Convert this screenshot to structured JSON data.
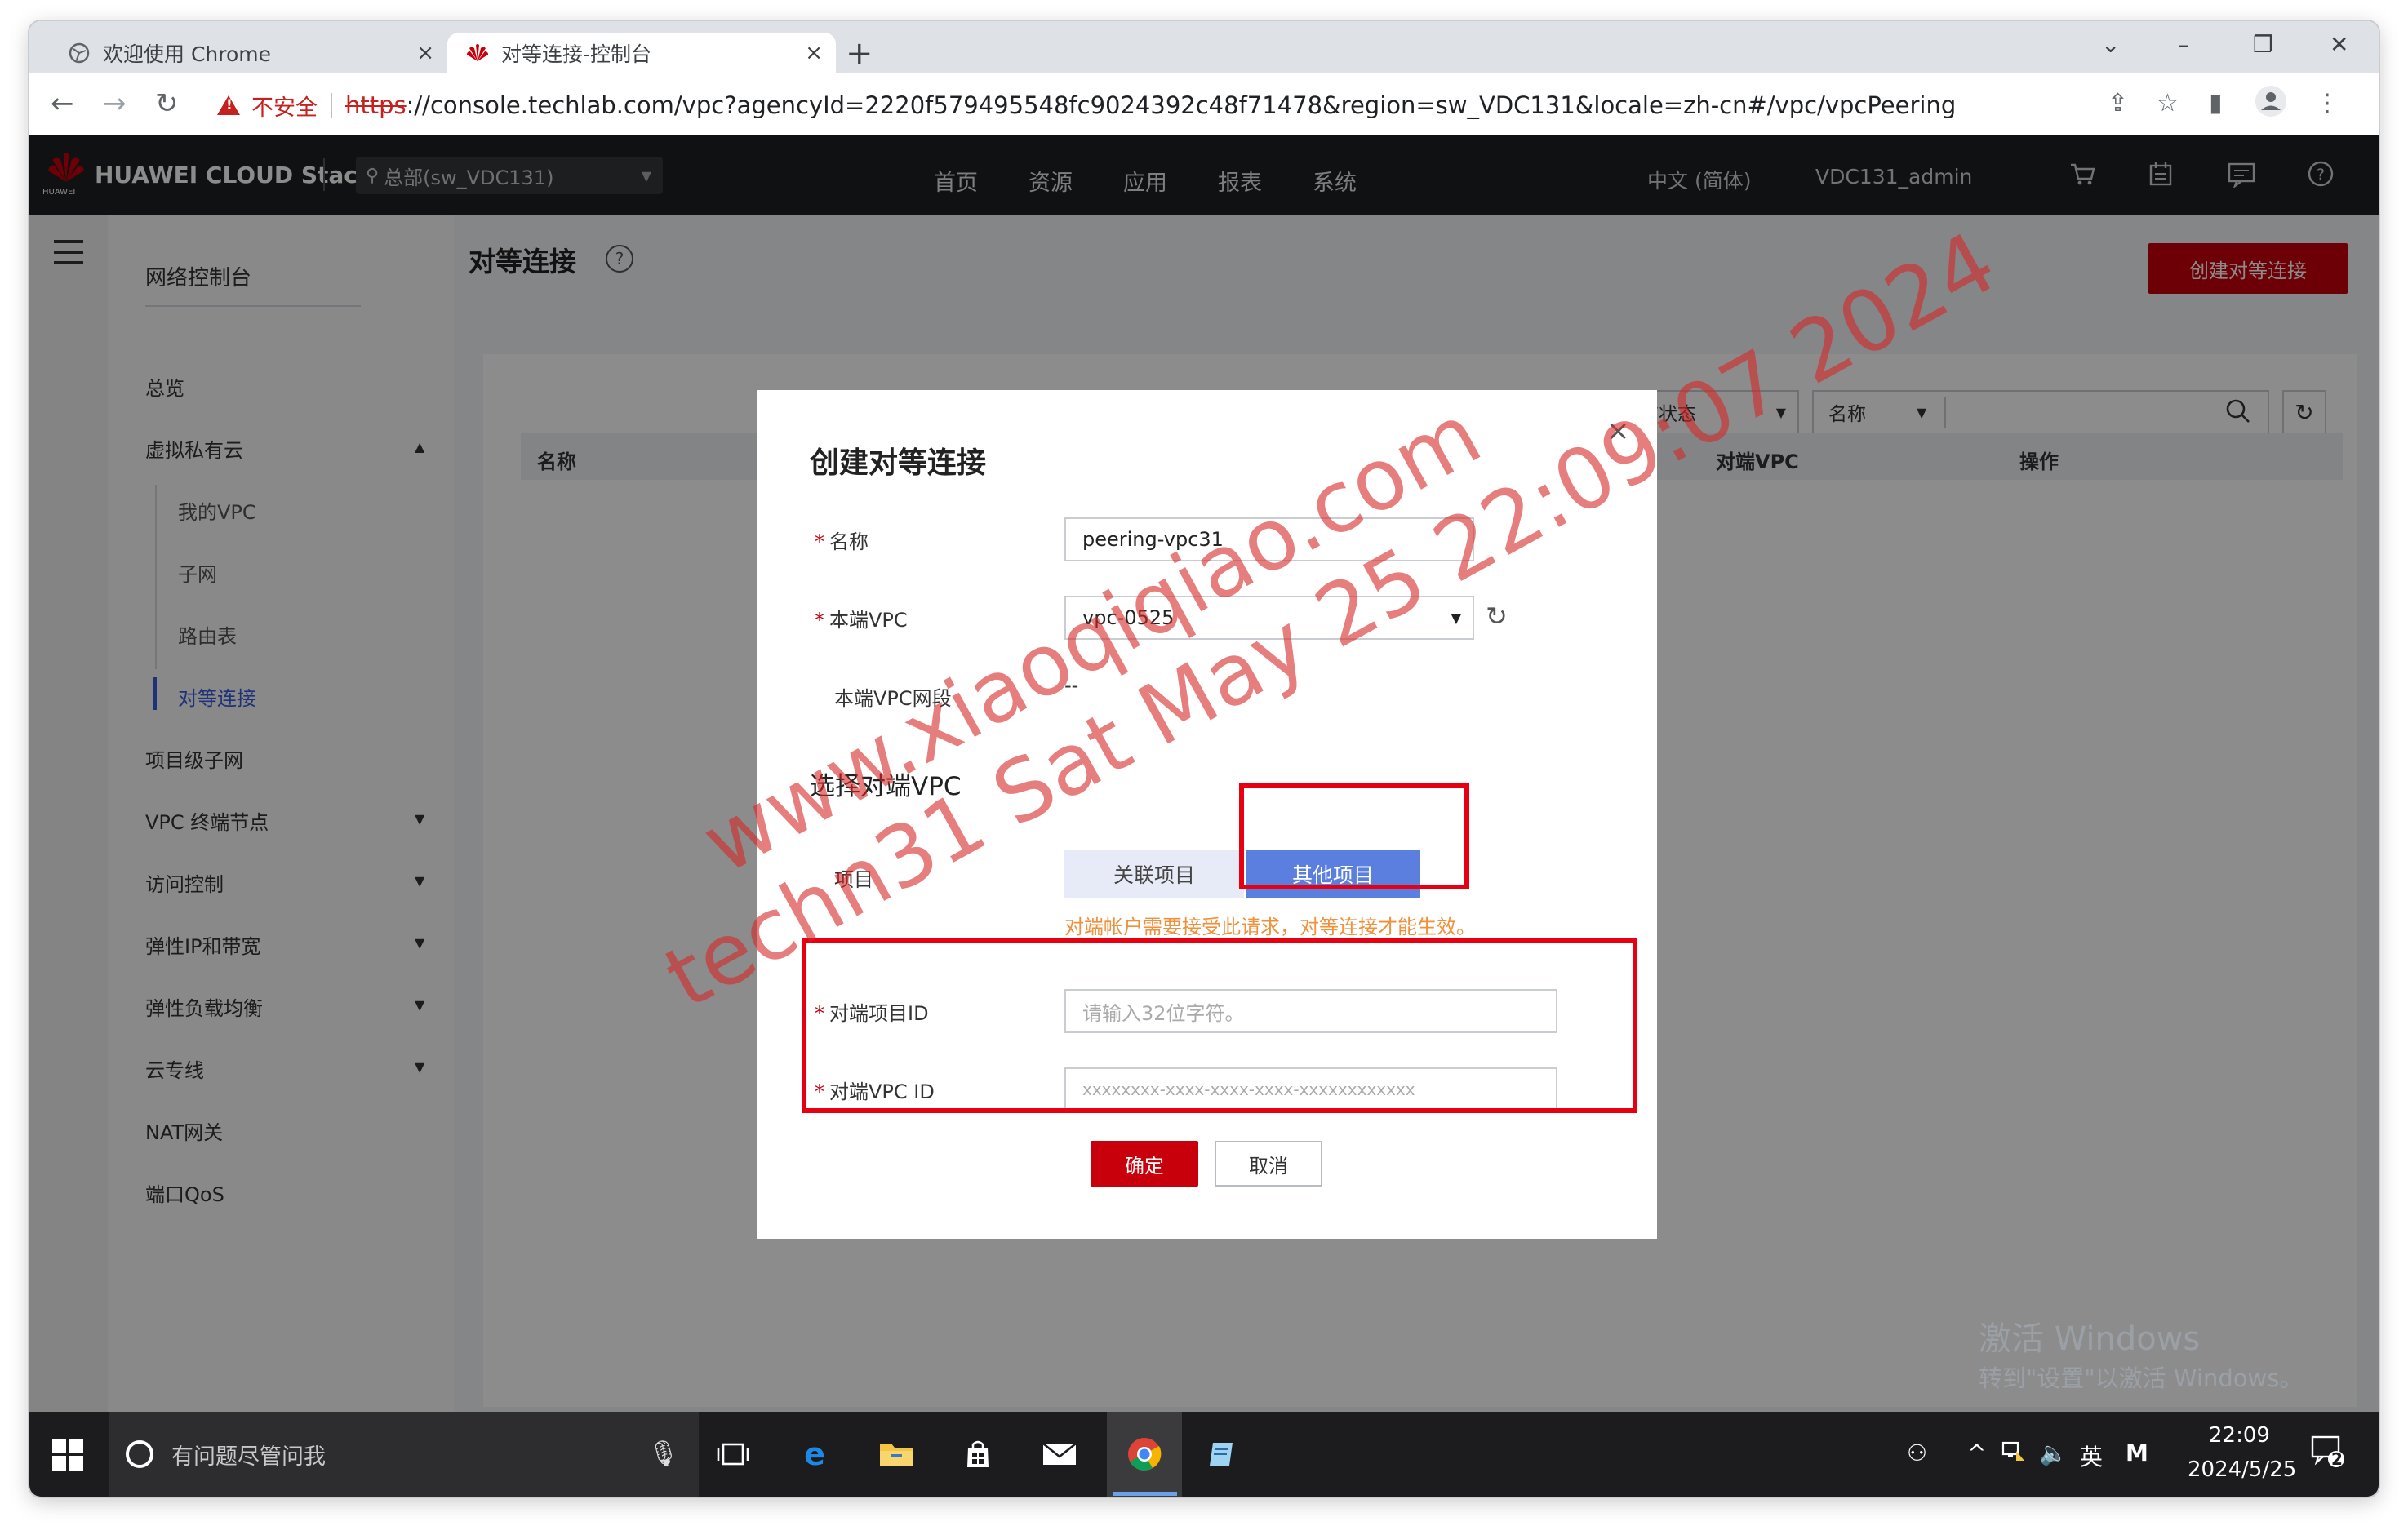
{
  "browser": {
    "tabs": [
      {
        "title": "欢迎使用 Chrome",
        "close": "×"
      },
      {
        "title": "对等连接-控制台",
        "close": "×"
      }
    ],
    "new_tab": "+",
    "window_controls": {
      "list": "⌄",
      "minimize": "–",
      "restore": "❐",
      "close": "✕"
    },
    "nav": {
      "back": "←",
      "forward": "→",
      "reload": "↻"
    },
    "security_label": "不安全",
    "url_scheme": "https",
    "url_rest": "://console.techlab.com/vpc?agencyId=2220f579495548fc9024392c48f71478&region=sw_VDC131&locale=zh-cn#/vpc/vpcPeering"
  },
  "header": {
    "logo_text": "HUAWEI CLOUD Stack",
    "logo_sub": "HUAWEI",
    "region": "总部(sw_VDC131)",
    "nav": [
      "首页",
      "资源",
      "应用",
      "报表",
      "系统"
    ],
    "language": "中文 (简体)",
    "user": "VDC131_admin",
    "icons": [
      "cart-icon",
      "calendar-icon",
      "message-icon",
      "help-icon"
    ]
  },
  "sidebar": {
    "title": "网络控制台",
    "items": [
      {
        "label": "总览"
      },
      {
        "label": "虚拟私有云",
        "expanded": true
      },
      {
        "label": "我的VPC",
        "sub": true
      },
      {
        "label": "子网",
        "sub": true
      },
      {
        "label": "路由表",
        "sub": true
      },
      {
        "label": "对等连接",
        "sub": true,
        "active": true
      },
      {
        "label": "项目级子网"
      },
      {
        "label": "VPC 终端节点"
      },
      {
        "label": "访问控制"
      },
      {
        "label": "弹性IP和带宽"
      },
      {
        "label": "弹性负载均衡"
      },
      {
        "label": "云专线"
      },
      {
        "label": "NAT网关"
      },
      {
        "label": "端口QoS"
      }
    ]
  },
  "page": {
    "title": "对等连接",
    "create_button": "创建对等连接",
    "filters": {
      "status": "所有状态",
      "field": "名称",
      "search_placeholder": ""
    },
    "table_headers": [
      "名称",
      "对端VPC",
      "操作"
    ]
  },
  "dialog": {
    "title": "创建对等连接",
    "close": "×",
    "fields": {
      "name_label": "名称",
      "name_value": "peering-vpc31",
      "local_vpc_label": "本端VPC",
      "local_vpc_value": "vpc-0525",
      "local_cidr_label": "本端VPC网段",
      "local_cidr_value": "--"
    },
    "section_title": "选择对端VPC",
    "project_label": "项目",
    "project_options": [
      "关联项目",
      "其他项目"
    ],
    "project_selected": "其他项目",
    "warning": "对端帐户需要接受此请求，对等连接才能生效。",
    "peer_project_id_label": "对端项目ID",
    "peer_project_id_placeholder": "请输入32位字符。",
    "peer_vpc_id_label": "对端VPC ID",
    "peer_vpc_id_placeholder": "xxxxxxxx-xxxx-xxxx-xxxx-xxxxxxxxxxxx",
    "ok": "确定",
    "cancel": "取消"
  },
  "watermark": "techn31 Sat May 25 22:09:07 2024",
  "watermark_url": "www.xiaoqiqiao.com",
  "activation": {
    "line1": "激活 Windows",
    "line2": "转到\"设置\"以激活 Windows。"
  },
  "taskbar": {
    "search_text": "有问题尽管问我",
    "ime": "英",
    "time": "22:09",
    "date": "2024/5/25",
    "notifications": "2"
  },
  "colors": {
    "brand_red": "#c7000b",
    "annotation_red": "#e60012",
    "selected_blue": "#5b7fdf",
    "active_link": "#3a5bd9"
  }
}
